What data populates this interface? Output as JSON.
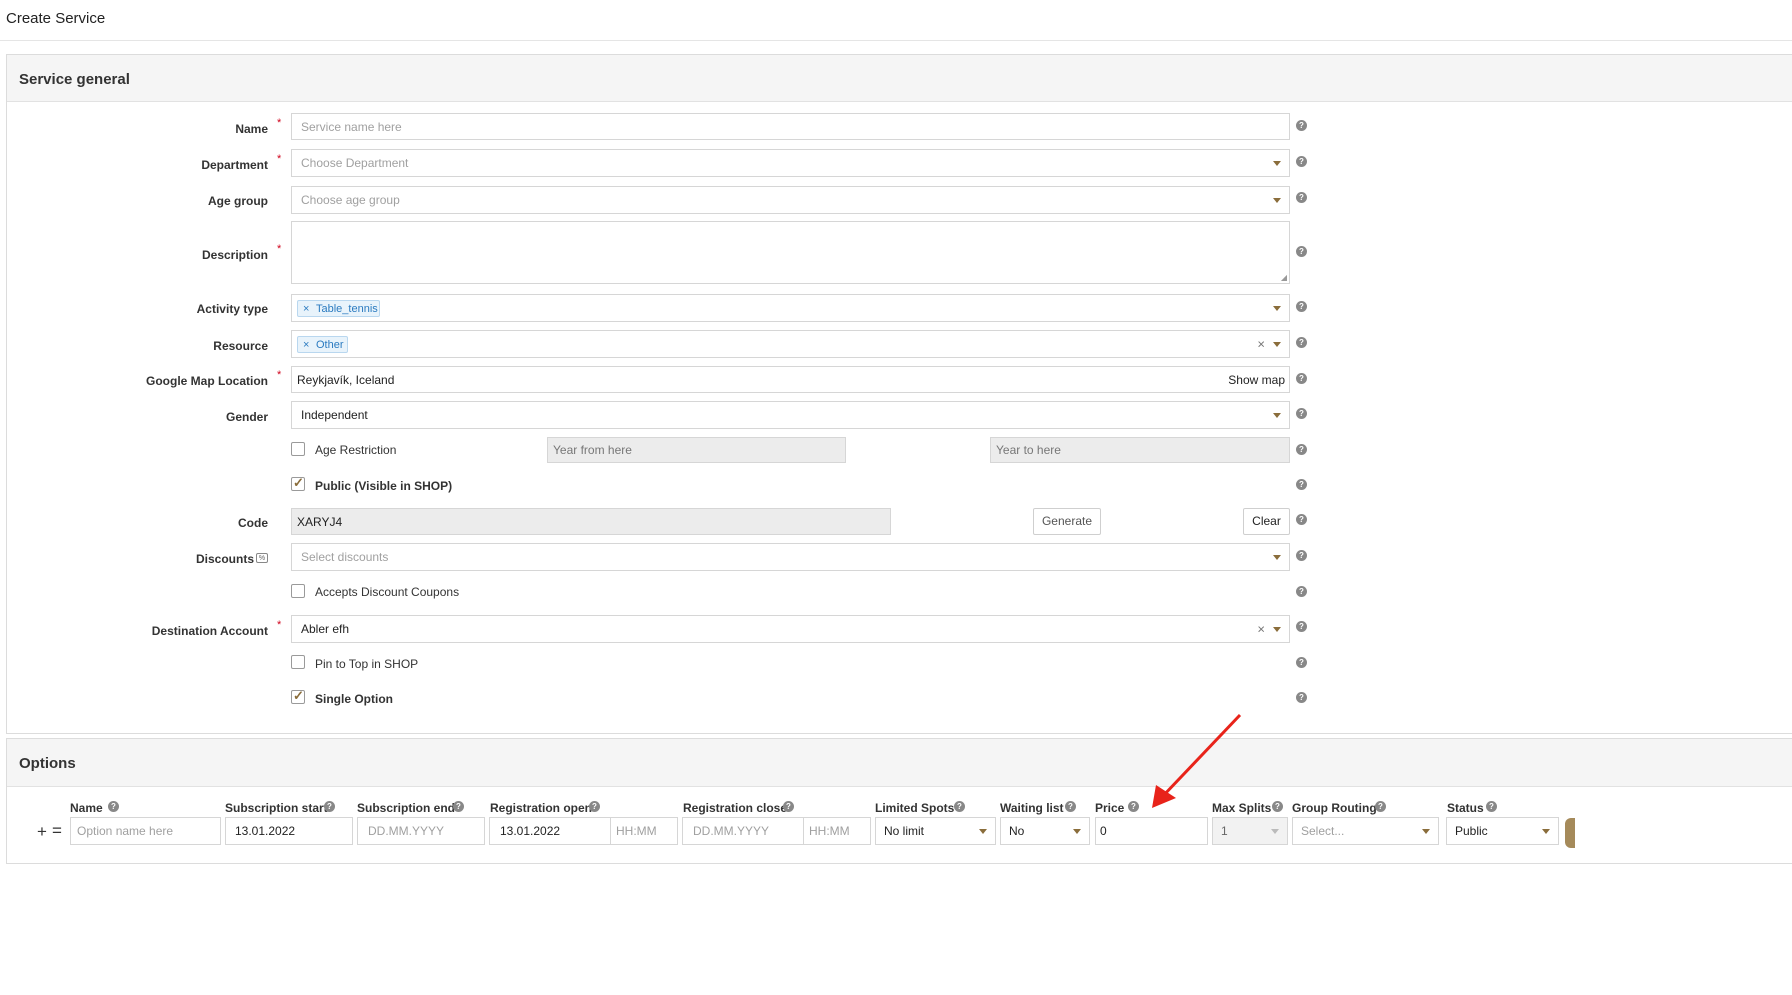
{
  "page_title": "Create Service",
  "service_general": {
    "title": "Service general",
    "name": {
      "label": "Name",
      "placeholder": "Service name here"
    },
    "department": {
      "label": "Department",
      "placeholder": "Choose Department"
    },
    "age_group": {
      "label": "Age group",
      "placeholder": "Choose age group"
    },
    "description": {
      "label": "Description"
    },
    "activity_type": {
      "label": "Activity type",
      "tags": [
        "Table_tennis"
      ]
    },
    "resource": {
      "label": "Resource",
      "tags": [
        "Other"
      ]
    },
    "location": {
      "label": "Google Map Location",
      "value": "Reykjavík, Iceland",
      "show_map": "Show map"
    },
    "gender": {
      "label": "Gender",
      "value": "Independent"
    },
    "age_restriction": {
      "label": "Age Restriction",
      "checked": false,
      "year_from_placeholder": "Year from here",
      "year_to_placeholder": "Year to here"
    },
    "public": {
      "label": "Public (Visible in SHOP)",
      "checked": true
    },
    "code": {
      "label": "Code",
      "value": "XARYJ4",
      "generate": "Generate",
      "clear": "Clear"
    },
    "discounts": {
      "label": "Discounts",
      "placeholder": "Select discounts"
    },
    "accepts_coupons": {
      "label": "Accepts Discount Coupons",
      "checked": false
    },
    "destination_account": {
      "label": "Destination Account",
      "value": "Abler efh"
    },
    "pin_to_top": {
      "label": "Pin to Top in SHOP",
      "checked": false
    },
    "single_option": {
      "label": "Single Option",
      "checked": true
    }
  },
  "options": {
    "title": "Options",
    "columns": {
      "name": "Name",
      "subscription_start": "Subscription start",
      "subscription_end": "Subscription end",
      "registration_open": "Registration open",
      "registration_close": "Registration close",
      "limited_spots": "Limited Spots",
      "waiting_list": "Waiting list",
      "price": "Price",
      "max_splits": "Max Splits",
      "group_routing": "Group Routing",
      "status": "Status"
    },
    "row": {
      "add_glyph": "+",
      "drag_glyph": "=",
      "name_placeholder": "Option name here",
      "subscription_start": "13.01.2022",
      "subscription_end_placeholder": "DD.MM.YYYY",
      "registration_open": "13.01.2022",
      "registration_open_time_placeholder": "HH:MM",
      "registration_close_placeholder": "DD.MM.YYYY",
      "registration_close_time_placeholder": "HH:MM",
      "limited_spots": "No limit",
      "waiting_list": "No",
      "price": "0",
      "max_splits": "1",
      "group_routing_placeholder": "Select...",
      "status": "Public"
    }
  },
  "colors": {
    "accent": "#8a6d3b",
    "required": "#d0021b",
    "tag_bg": "#e8f3fb",
    "tag_text": "#2b7bc0",
    "annotation_arrow": "#e8231a"
  }
}
